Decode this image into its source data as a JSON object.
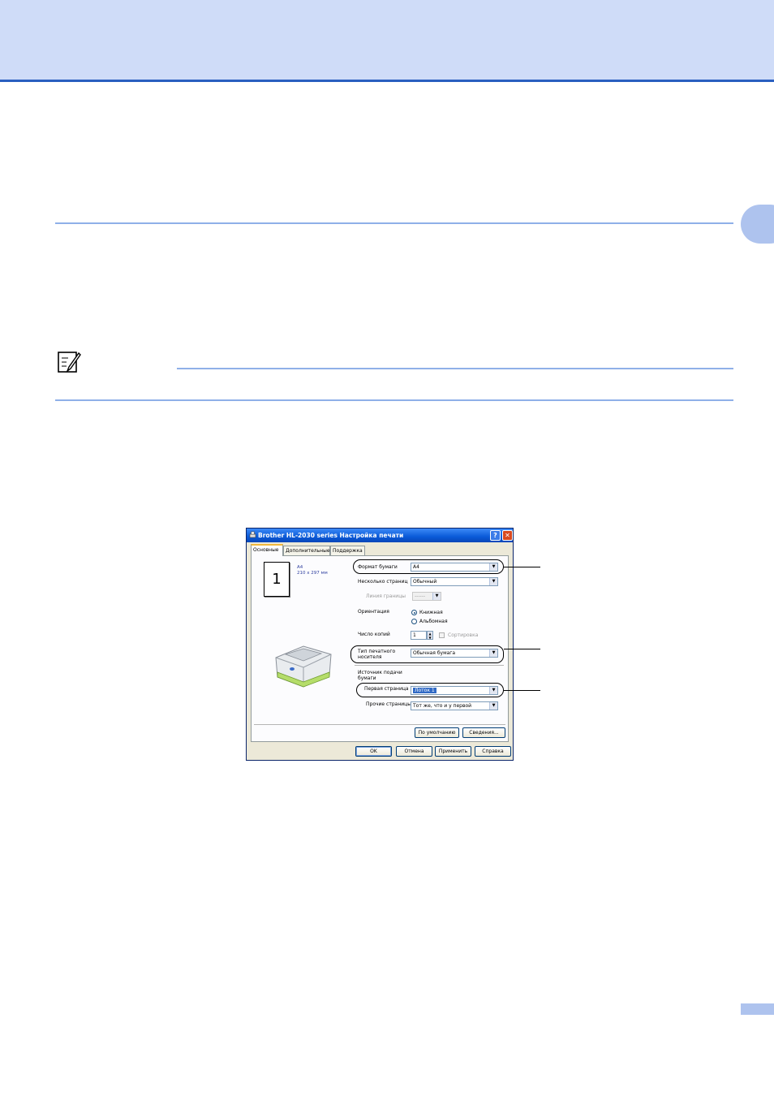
{
  "dialog": {
    "title": "Brother HL-2030 series Настройка печати",
    "help_label": "?",
    "close_label": "✕",
    "tabs": [
      {
        "label": "Основные",
        "active": true
      },
      {
        "label": "Дополнительные",
        "active": false
      },
      {
        "label": "Поддержка",
        "active": false
      }
    ],
    "preview": {
      "page_number": "1",
      "paper_name": "A4",
      "paper_size": "210 x 297 мм"
    },
    "fields": {
      "paper_size_label": "Формат бумаги",
      "paper_size_value": "A4",
      "multiple_page_label": "Несколько страниц",
      "multiple_page_value": "Обычный",
      "border_line_label": "Линия границы",
      "border_line_value": "------",
      "orientation_label": "Ориентация",
      "orientation_portrait": "Книжная",
      "orientation_landscape": "Альбомная",
      "copies_label": "Число копий",
      "copies_value": "1",
      "collate_label": "Сортировка",
      "media_type_label_1": "Тип печатного",
      "media_type_label_2": "носителя",
      "media_type_value": "Обычная бумага",
      "paper_source_label_1": "Источник подачи",
      "paper_source_label_2": "бумаги",
      "first_page_label": "Первая страница",
      "first_page_value": "Лоток 1",
      "other_pages_label": "Прочие страницы",
      "other_pages_value": "Тот же, что и у первой"
    },
    "buttons": {
      "default_label": "По умолчанию",
      "about_label": "Сведения...",
      "ok_label": "OK",
      "cancel_label": "Отмена",
      "apply_label": "Применить",
      "help_label": "Справка"
    }
  }
}
